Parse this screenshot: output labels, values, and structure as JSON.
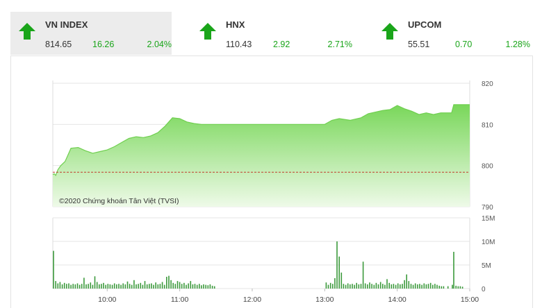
{
  "tiles": [
    {
      "name": "VN INDEX",
      "value": "814.65",
      "change": "16.26",
      "percent": "2.04%",
      "direction": "up",
      "active": true
    },
    {
      "name": "HNX",
      "value": "110.43",
      "change": "2.92",
      "percent": "2.71%",
      "direction": "up",
      "active": false
    },
    {
      "name": "UPCOM",
      "value": "55.51",
      "change": "0.70",
      "percent": "1.28%",
      "direction": "up",
      "active": false
    }
  ],
  "colors": {
    "up": "#1aa51a",
    "area_top": "#79d75a",
    "area_bottom": "#eefae8",
    "reference": "#c0392b",
    "volume": "#3c9a3c"
  },
  "copyright": "©2020 Chứng khoán Tân Việt (TVSI)",
  "chart_data": [
    {
      "type": "area",
      "x_unit": "time",
      "ylim": [
        790,
        820
      ],
      "yticks": [
        "820",
        "810",
        "800",
        "790"
      ],
      "reference_price": 798.39,
      "grid": true,
      "series": [
        {
          "values": [
            [
              9.25,
              797.8
            ],
            [
              9.27,
              798.0
            ],
            [
              9.29,
              797.6
            ],
            [
              9.32,
              799.0
            ],
            [
              9.36,
              800.0
            ],
            [
              9.42,
              801.0
            ],
            [
              9.5,
              804.2
            ],
            [
              9.6,
              804.4
            ],
            [
              9.7,
              803.6
            ],
            [
              9.8,
              803.0
            ],
            [
              9.9,
              803.4
            ],
            [
              10.0,
              803.8
            ],
            [
              10.1,
              804.6
            ],
            [
              10.2,
              805.6
            ],
            [
              10.3,
              806.6
            ],
            [
              10.4,
              807.0
            ],
            [
              10.5,
              806.8
            ],
            [
              10.6,
              807.2
            ],
            [
              10.7,
              808.0
            ],
            [
              10.8,
              809.6
            ],
            [
              10.9,
              811.6
            ],
            [
              11.0,
              811.4
            ],
            [
              11.1,
              810.6
            ],
            [
              11.2,
              810.2
            ],
            [
              11.3,
              810.0
            ],
            [
              11.5,
              810.0
            ],
            [
              11.75,
              810.0
            ],
            [
              12.0,
              810.0
            ],
            [
              12.5,
              810.0
            ],
            [
              13.0,
              810.0
            ],
            [
              13.1,
              811.0
            ],
            [
              13.2,
              811.4
            ],
            [
              13.35,
              811.0
            ],
            [
              13.5,
              811.6
            ],
            [
              13.6,
              812.6
            ],
            [
              13.8,
              813.4
            ],
            [
              13.9,
              813.6
            ],
            [
              14.0,
              814.6
            ],
            [
              14.1,
              813.8
            ],
            [
              14.2,
              813.2
            ],
            [
              14.3,
              812.4
            ],
            [
              14.4,
              812.8
            ],
            [
              14.5,
              812.4
            ],
            [
              14.6,
              812.8
            ],
            [
              14.75,
              812.8
            ],
            [
              14.78,
              814.8
            ],
            [
              15.0,
              814.8
            ]
          ]
        }
      ]
    },
    {
      "type": "bar",
      "x_unit": "time",
      "ylim": [
        0,
        15
      ],
      "yticks": [
        "15M",
        "10M",
        "5M",
        "0"
      ],
      "xticks": [
        "10:00",
        "11:00",
        "12:00",
        "13:00",
        "14:00",
        "15:00"
      ],
      "grid": true,
      "series": [
        {
          "values": [
            [
              9.26,
              8.0
            ],
            [
              9.29,
              1.6
            ],
            [
              9.32,
              1.1
            ],
            [
              9.35,
              1.4
            ],
            [
              9.38,
              0.9
            ],
            [
              9.41,
              1.2
            ],
            [
              9.44,
              1.0
            ],
            [
              9.47,
              1.1
            ],
            [
              9.5,
              0.8
            ],
            [
              9.53,
              1.0
            ],
            [
              9.56,
              0.9
            ],
            [
              9.59,
              1.1
            ],
            [
              9.62,
              0.8
            ],
            [
              9.65,
              1.0
            ],
            [
              9.68,
              2.3
            ],
            [
              9.71,
              0.9
            ],
            [
              9.74,
              1.0
            ],
            [
              9.77,
              1.3
            ],
            [
              9.8,
              0.8
            ],
            [
              9.83,
              2.6
            ],
            [
              9.86,
              1.4
            ],
            [
              9.89,
              0.9
            ],
            [
              9.92,
              1.0
            ],
            [
              9.95,
              1.2
            ],
            [
              9.98,
              0.8
            ],
            [
              10.01,
              1.0
            ],
            [
              10.04,
              0.9
            ],
            [
              10.07,
              0.8
            ],
            [
              10.1,
              1.1
            ],
            [
              10.13,
              0.9
            ],
            [
              10.16,
              1.0
            ],
            [
              10.19,
              0.8
            ],
            [
              10.22,
              1.1
            ],
            [
              10.25,
              0.9
            ],
            [
              10.28,
              1.5
            ],
            [
              10.31,
              1.0
            ],
            [
              10.34,
              0.8
            ],
            [
              10.37,
              1.8
            ],
            [
              10.4,
              0.9
            ],
            [
              10.43,
              1.0
            ],
            [
              10.46,
              1.2
            ],
            [
              10.49,
              0.8
            ],
            [
              10.52,
              1.6
            ],
            [
              10.55,
              0.9
            ],
            [
              10.58,
              1.0
            ],
            [
              10.61,
              1.1
            ],
            [
              10.64,
              0.8
            ],
            [
              10.67,
              1.3
            ],
            [
              10.7,
              0.9
            ],
            [
              10.73,
              1.0
            ],
            [
              10.76,
              1.4
            ],
            [
              10.79,
              0.8
            ],
            [
              10.82,
              2.5
            ],
            [
              10.85,
              2.7
            ],
            [
              10.88,
              1.8
            ],
            [
              10.91,
              1.2
            ],
            [
              10.94,
              1.0
            ],
            [
              10.97,
              1.6
            ],
            [
              11.0,
              1.4
            ],
            [
              11.03,
              1.0
            ],
            [
              11.06,
              1.2
            ],
            [
              11.09,
              0.8
            ],
            [
              11.12,
              1.1
            ],
            [
              11.15,
              1.6
            ],
            [
              11.18,
              0.9
            ],
            [
              11.21,
              1.0
            ],
            [
              11.24,
              0.8
            ],
            [
              11.27,
              1.0
            ],
            [
              11.3,
              0.7
            ],
            [
              11.33,
              0.9
            ],
            [
              11.36,
              0.8
            ],
            [
              11.39,
              0.7
            ],
            [
              11.42,
              0.9
            ],
            [
              11.45,
              0.6
            ],
            [
              11.48,
              0.5
            ],
            [
              13.02,
              1.3
            ],
            [
              13.05,
              0.8
            ],
            [
              13.08,
              1.2
            ],
            [
              13.11,
              1.0
            ],
            [
              13.14,
              2.2
            ],
            [
              13.17,
              10.0
            ],
            [
              13.2,
              6.8
            ],
            [
              13.23,
              3.4
            ],
            [
              13.26,
              1.0
            ],
            [
              13.29,
              0.8
            ],
            [
              13.32,
              1.1
            ],
            [
              13.35,
              0.9
            ],
            [
              13.38,
              1.0
            ],
            [
              13.41,
              0.8
            ],
            [
              13.44,
              1.2
            ],
            [
              13.47,
              0.9
            ],
            [
              13.5,
              1.0
            ],
            [
              13.53,
              5.7
            ],
            [
              13.56,
              1.1
            ],
            [
              13.59,
              0.9
            ],
            [
              13.62,
              1.3
            ],
            [
              13.65,
              1.0
            ],
            [
              13.68,
              0.8
            ],
            [
              13.71,
              1.2
            ],
            [
              13.74,
              0.9
            ],
            [
              13.77,
              1.4
            ],
            [
              13.8,
              1.0
            ],
            [
              13.83,
              0.8
            ],
            [
              13.86,
              2.0
            ],
            [
              13.89,
              1.2
            ],
            [
              13.92,
              0.9
            ],
            [
              13.95,
              1.0
            ],
            [
              13.98,
              0.8
            ],
            [
              14.01,
              1.1
            ],
            [
              14.04,
              0.9
            ],
            [
              14.07,
              1.0
            ],
            [
              14.1,
              1.8
            ],
            [
              14.13,
              3.0
            ],
            [
              14.16,
              1.6
            ],
            [
              14.19,
              1.0
            ],
            [
              14.22,
              0.8
            ],
            [
              14.25,
              1.1
            ],
            [
              14.28,
              0.9
            ],
            [
              14.31,
              1.0
            ],
            [
              14.34,
              0.8
            ],
            [
              14.37,
              1.1
            ],
            [
              14.4,
              0.9
            ],
            [
              14.43,
              1.0
            ],
            [
              14.46,
              1.2
            ],
            [
              14.49,
              0.8
            ],
            [
              14.52,
              1.0
            ],
            [
              14.55,
              0.8
            ],
            [
              14.58,
              0.6
            ],
            [
              14.61,
              0.5
            ],
            [
              14.64,
              0.5
            ],
            [
              14.7,
              0.5
            ],
            [
              14.76,
              0.8
            ],
            [
              14.78,
              7.8
            ],
            [
              14.81,
              0.6
            ],
            [
              14.84,
              0.5
            ],
            [
              14.87,
              0.5
            ],
            [
              14.9,
              0.4
            ]
          ]
        }
      ]
    }
  ]
}
